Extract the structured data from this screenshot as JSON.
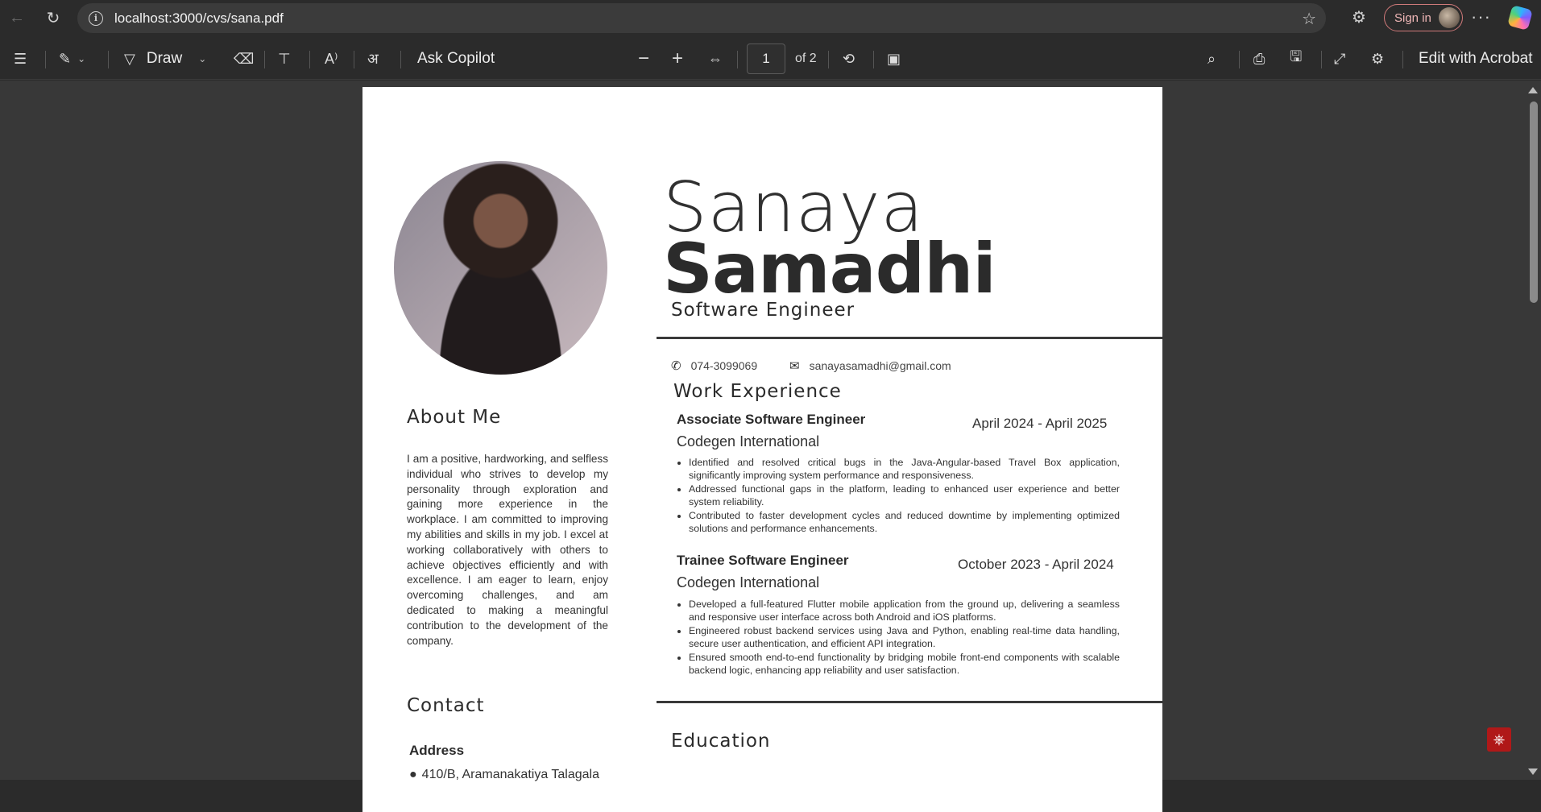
{
  "browser": {
    "url": "localhost:3000/cvs/sana.pdf",
    "sign_in": "Sign in",
    "more": "···"
  },
  "toolbar": {
    "draw_label": "Draw",
    "ask_copilot": "Ask Copilot",
    "page_current": "1",
    "page_total": "of 2",
    "edit_acrobat": "Edit with Acrobat",
    "zoom_out": "−",
    "zoom_in": "+"
  },
  "resume": {
    "first_name": "Sanaya",
    "last_name": "Samadhi",
    "title": "Software Engineer",
    "phone": "074-3099069",
    "email": "sanayasamadhi@gmail.com",
    "about_heading": "About Me",
    "about_text": "I am a positive, hardworking, and selfless individual who strives to develop my personality through exploration and gaining more experience in the workplace. I am committed to improving my abilities and skills in my job. I excel at working collaboratively with others to achieve objectives efficiently and with excellence. I am eager to learn, enjoy overcoming challenges, and am dedicated to making a meaningful contribution to the development of the company.",
    "contact_heading": "Contact",
    "address_label": "Address",
    "address_text": "410/B, Aramanakatiya Talagala",
    "work_heading": "Work Experience",
    "education_heading": "Education",
    "jobs": [
      {
        "role": "Associate Software Engineer",
        "dates": "April 2024 - April 2025",
        "company": "Codegen International",
        "bullets": [
          "Identified and resolved critical bugs in the Java-Angular-based Travel Box application, significantly improving system performance and responsiveness.",
          "Addressed functional gaps in the platform, leading to enhanced user experience and better system reliability.",
          "Contributed to faster development cycles and reduced downtime by implementing optimized solutions and performance enhancements."
        ]
      },
      {
        "role": "Trainee Software Engineer",
        "dates": "October 2023 - April 2024",
        "company": "Codegen International",
        "bullets": [
          "Developed a full-featured Flutter mobile application from the ground up, delivering a seamless and responsive user interface across both Android and iOS platforms.",
          "Engineered robust backend services using Java and Python, enabling real-time data handling, secure user authentication, and efficient API integration.",
          "Ensured smooth end-to-end functionality by bridging mobile front-end components with scalable backend logic, enhancing app reliability and user satisfaction."
        ]
      }
    ]
  }
}
